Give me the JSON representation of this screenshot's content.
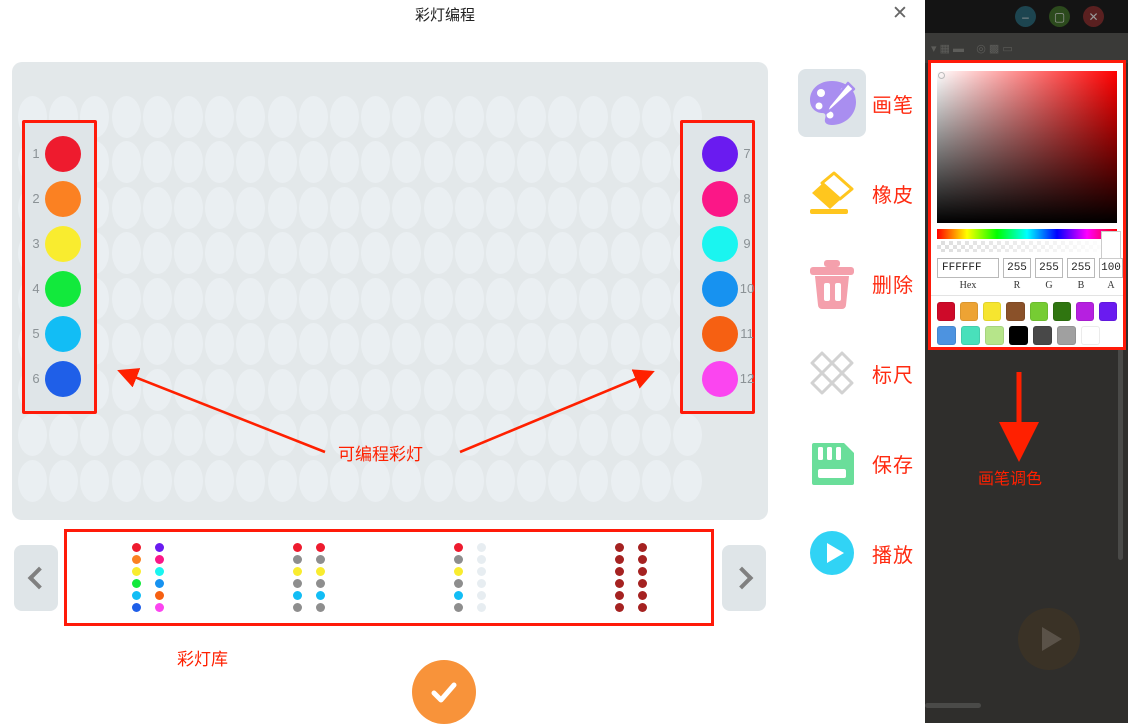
{
  "dialog": {
    "title": "彩灯编程",
    "close_label": "✕"
  },
  "background_app": {
    "window_buttons": [
      "minimize",
      "maximize",
      "close"
    ],
    "play_icon": "play-icon"
  },
  "leds": {
    "left_column": [
      {
        "num": "1",
        "color": "#ee1b2e"
      },
      {
        "num": "2",
        "color": "#fb8122"
      },
      {
        "num": "3",
        "color": "#f9ec2f"
      },
      {
        "num": "4",
        "color": "#12e93c"
      },
      {
        "num": "5",
        "color": "#12bdf5"
      },
      {
        "num": "6",
        "color": "#1f5fe8"
      }
    ],
    "right_column": [
      {
        "num": "7",
        "color": "#6a1bf0"
      },
      {
        "num": "8",
        "color": "#fb1787"
      },
      {
        "num": "9",
        "color": "#1af5f0"
      },
      {
        "num": "10",
        "color": "#1792f0"
      },
      {
        "num": "11",
        "color": "#f66012"
      },
      {
        "num": "12",
        "color": "#fb45f0"
      }
    ]
  },
  "toolbar": {
    "items": [
      {
        "label": "画笔",
        "icon": "brush-palette-icon",
        "active": true
      },
      {
        "label": "橡皮",
        "icon": "eraser-icon",
        "active": false
      },
      {
        "label": "删除",
        "icon": "trash-icon",
        "active": false
      },
      {
        "label": "标尺",
        "icon": "ruler-icon",
        "active": false
      },
      {
        "label": "保存",
        "icon": "save-card-icon",
        "active": false
      },
      {
        "label": "播放",
        "icon": "play-circle-icon",
        "active": false
      }
    ]
  },
  "annotations": {
    "leds": "可编程彩灯",
    "library": "彩灯库",
    "palette": "画笔调色",
    "color": "#ff2000"
  },
  "library": {
    "prev_label": "‹",
    "next_label": "›",
    "items": [
      {
        "left": [
          "#ee1b2e",
          "#fb8122",
          "#f9ec2f",
          "#12e93c",
          "#12bdf5",
          "#1f5fe8"
        ],
        "right": [
          "#6a1bf0",
          "#fb1787",
          "#1af5f0",
          "#1792f0",
          "#f66012",
          "#fb45f0"
        ]
      },
      {
        "left": [
          "#ee1b2e",
          "#8e8e8e",
          "#f9ec2f",
          "#8e8e8e",
          "#12bdf5",
          "#8e8e8e"
        ],
        "right": [
          "#ee1b2e",
          "#8e8e8e",
          "#f9ec2f",
          "#8e8e8e",
          "#12bdf5",
          "#8e8e8e"
        ]
      },
      {
        "left": [
          "#ee1b2e",
          "#8e8e8e",
          "#f9ec2f",
          "#8e8e8e",
          "#12bdf5",
          "#8e8e8e"
        ],
        "right": [
          "#e7edf1",
          "#e7edf1",
          "#e7edf1",
          "#e7edf1",
          "#e7edf1",
          "#e7edf1"
        ]
      },
      {
        "left": [
          "#a52221",
          "#a52221",
          "#a52221",
          "#a52221",
          "#a52221",
          "#a52221"
        ],
        "right": [
          "#a52221",
          "#a52221",
          "#a52221",
          "#a52221",
          "#a52221",
          "#a52221"
        ]
      }
    ]
  },
  "confirm": {
    "icon": "check-icon"
  },
  "color_picker": {
    "hex": "FFFFFF",
    "r": "255",
    "g": "255",
    "b": "255",
    "a": "100",
    "hex_caption": "Hex",
    "r_caption": "R",
    "g_caption": "G",
    "b_caption": "B",
    "a_caption": "A",
    "preview": "#ffffff",
    "swatches_row1": [
      "#ce0a29",
      "#eda334",
      "#f6e52f",
      "#8a5129",
      "#76cc33",
      "#2f7510",
      "#b620e0",
      "#6a1bf0"
    ],
    "swatches_row2": [
      "#4d93e0",
      "#49e0bb",
      "#b6e58a",
      "#000000",
      "#484848",
      "#a0a0a0",
      "#ffffff"
    ]
  }
}
